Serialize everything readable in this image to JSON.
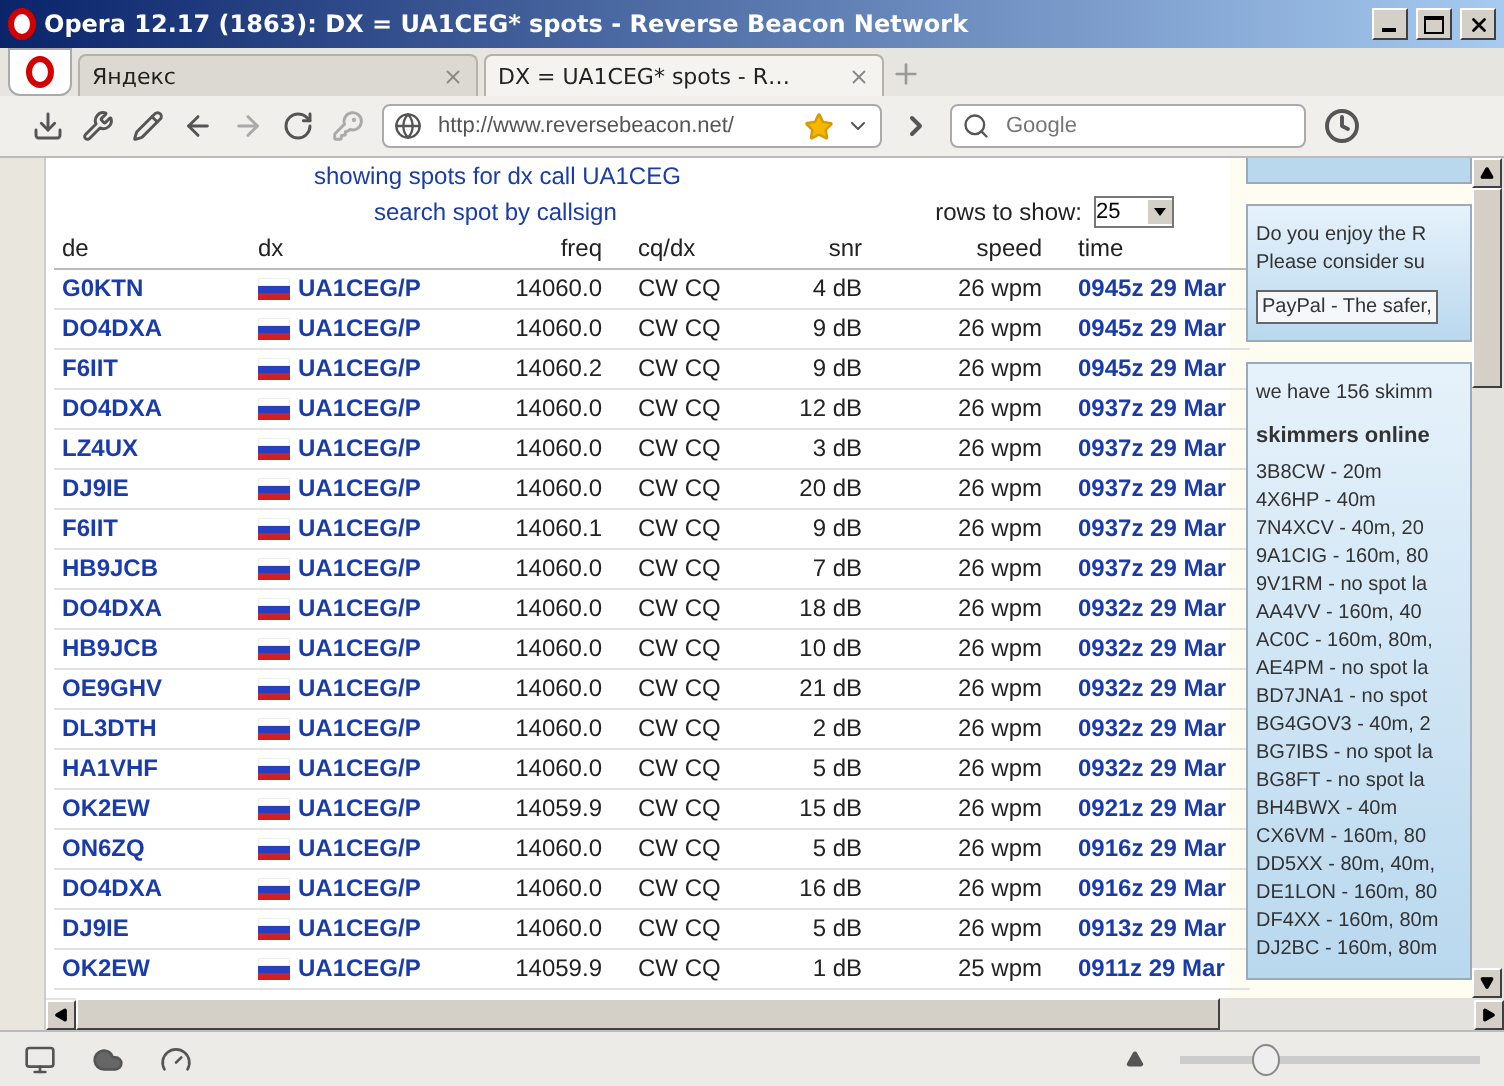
{
  "window": {
    "title": "Opera 12.17 (1863): DX = UA1CEG* spots - Reverse Beacon Network"
  },
  "tabs": [
    {
      "label": "Яндекс",
      "selected": false
    },
    {
      "label": "DX = UA1CEG* spots - R…",
      "selected": true
    }
  ],
  "address": {
    "value": "http://www.reversebeacon.net/"
  },
  "search": {
    "placeholder": "Google"
  },
  "page": {
    "heading": "showing spots for dx call UA1CEG",
    "search_link": "search spot by callsign",
    "rows_label": "rows to show:",
    "rows_value": "25"
  },
  "table": {
    "columns": [
      "de",
      "dx",
      "freq",
      "cq/dx",
      "snr",
      "speed",
      "time"
    ],
    "rows": [
      [
        "G0KTN",
        "UA1CEG/P",
        "14060.0",
        "CW CQ",
        "4 dB",
        "26 wpm",
        "0945z 29 Mar"
      ],
      [
        "DO4DXA",
        "UA1CEG/P",
        "14060.0",
        "CW CQ",
        "9 dB",
        "26 wpm",
        "0945z 29 Mar"
      ],
      [
        "F6IIT",
        "UA1CEG/P",
        "14060.2",
        "CW CQ",
        "9 dB",
        "26 wpm",
        "0945z 29 Mar"
      ],
      [
        "DO4DXA",
        "UA1CEG/P",
        "14060.0",
        "CW CQ",
        "12 dB",
        "26 wpm",
        "0937z 29 Mar"
      ],
      [
        "LZ4UX",
        "UA1CEG/P",
        "14060.0",
        "CW CQ",
        "3 dB",
        "26 wpm",
        "0937z 29 Mar"
      ],
      [
        "DJ9IE",
        "UA1CEG/P",
        "14060.0",
        "CW CQ",
        "20 dB",
        "26 wpm",
        "0937z 29 Mar"
      ],
      [
        "F6IIT",
        "UA1CEG/P",
        "14060.1",
        "CW CQ",
        "9 dB",
        "26 wpm",
        "0937z 29 Mar"
      ],
      [
        "HB9JCB",
        "UA1CEG/P",
        "14060.0",
        "CW CQ",
        "7 dB",
        "26 wpm",
        "0937z 29 Mar"
      ],
      [
        "DO4DXA",
        "UA1CEG/P",
        "14060.0",
        "CW CQ",
        "18 dB",
        "26 wpm",
        "0932z 29 Mar"
      ],
      [
        "HB9JCB",
        "UA1CEG/P",
        "14060.0",
        "CW CQ",
        "10 dB",
        "26 wpm",
        "0932z 29 Mar"
      ],
      [
        "OE9GHV",
        "UA1CEG/P",
        "14060.0",
        "CW CQ",
        "21 dB",
        "26 wpm",
        "0932z 29 Mar"
      ],
      [
        "DL3DTH",
        "UA1CEG/P",
        "14060.0",
        "CW CQ",
        "2 dB",
        "26 wpm",
        "0932z 29 Mar"
      ],
      [
        "HA1VHF",
        "UA1CEG/P",
        "14060.0",
        "CW CQ",
        "5 dB",
        "26 wpm",
        "0932z 29 Mar"
      ],
      [
        "OK2EW",
        "UA1CEG/P",
        "14059.9",
        "CW CQ",
        "15 dB",
        "26 wpm",
        "0921z 29 Mar"
      ],
      [
        "ON6ZQ",
        "UA1CEG/P",
        "14060.0",
        "CW CQ",
        "5 dB",
        "26 wpm",
        "0916z 29 Mar"
      ],
      [
        "DO4DXA",
        "UA1CEG/P",
        "14060.0",
        "CW CQ",
        "16 dB",
        "26 wpm",
        "0916z 29 Mar"
      ],
      [
        "DJ9IE",
        "UA1CEG/P",
        "14060.0",
        "CW CQ",
        "5 dB",
        "26 wpm",
        "0913z 29 Mar"
      ],
      [
        "OK2EW",
        "UA1CEG/P",
        "14059.9",
        "CW CQ",
        "1 dB",
        "25 wpm",
        "0911z 29 Mar"
      ]
    ]
  },
  "sidebar": {
    "donate_lines": [
      "Do you enjoy the R",
      "Please consider su"
    ],
    "paypal": "PayPal - The safer,",
    "count_text": "we have 156 skimm",
    "skimmers_title": "skimmers online",
    "skimmers": [
      "3B8CW - 20m",
      "4X6HP - 40m",
      "7N4XCV - 40m, 20",
      "9A1CIG - 160m, 80",
      "9V1RM - no spot la",
      "AA4VV - 160m, 40",
      "AC0C - 160m, 80m,",
      "AE4PM - no spot la",
      "BD7JNA1 - no spot",
      "BG4GOV3 - 40m, 2",
      "BG7IBS - no spot la",
      "BG8FT - no spot la",
      "BH4BWX - 40m",
      "CX6VM - 160m, 80",
      "DD5XX - 80m, 40m,",
      "DE1LON - 160m, 80",
      "DF4XX - 160m, 80m",
      "DJ2BC - 160m, 80m"
    ]
  },
  "status_bar": {
    "zoom": {
      "level": 0.28
    }
  }
}
